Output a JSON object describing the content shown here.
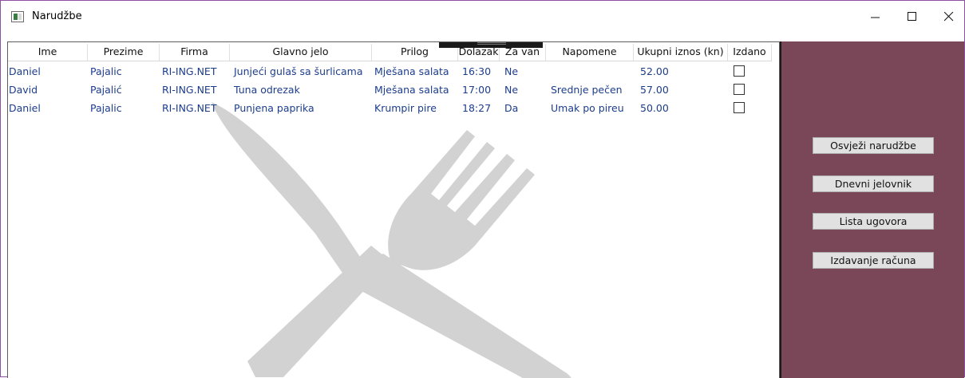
{
  "window": {
    "title": "Narudžbe"
  },
  "columns": [
    "Ime",
    "Prezime",
    "Firma",
    "Glavno jelo",
    "Prilog",
    "Dolazak",
    "Za van",
    "Napomene",
    "Ukupni iznos (kn)",
    "Izdano"
  ],
  "rows": [
    {
      "ime": "Daniel",
      "prezime": "Pajalic",
      "firma": "RI-ING.NET",
      "glavno_jelo": "Junjeći gulaš sa šurlicama",
      "prilog": "Mješana salata",
      "dolazak": "16:30",
      "za_van": "Ne",
      "napomene": "",
      "iznos": "52.00",
      "izdano": false
    },
    {
      "ime": "David",
      "prezime": "Pajalić",
      "firma": "RI-ING.NET",
      "glavno_jelo": "Tuna odrezak",
      "prilog": "Mješana salata",
      "dolazak": "17:00",
      "za_van": "Ne",
      "napomene": "Srednje pečen",
      "iznos": "57.00",
      "izdano": false
    },
    {
      "ime": "Daniel",
      "prezime": "Pajalic",
      "firma": "RI-ING.NET",
      "glavno_jelo": "Punjena paprika",
      "prilog": "Krumpir pire",
      "dolazak": "18:27",
      "za_van": "Da",
      "napomene": "Umak po pireu",
      "iznos": "50.00",
      "izdano": false
    }
  ],
  "side_buttons": {
    "refresh": "Osvježi narudžbe",
    "daily_menu": "Dnevni jelovnik",
    "contracts": "Lista ugovora",
    "invoice": "Izdavanje računa"
  },
  "colors": {
    "side_panel": "#7a4758",
    "cell_text": "#1c3d8c",
    "window_border": "#8d4fa0"
  },
  "icons": {
    "app": "app-window-icon",
    "watermark": "fork-and-knife-icon"
  }
}
